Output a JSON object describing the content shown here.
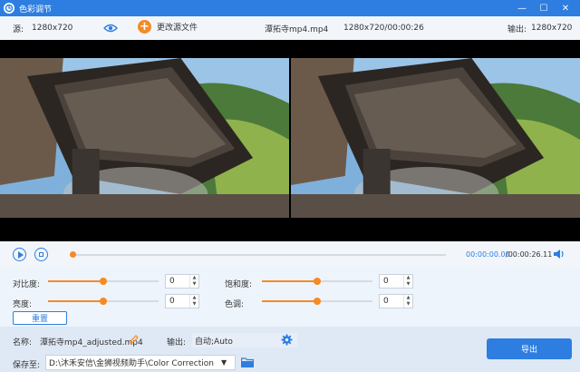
{
  "window": {
    "title": "色彩调节",
    "logo_icon": "app-logo-icon",
    "controls": [
      "minimize-icon",
      "maximize-icon",
      "close-icon"
    ]
  },
  "info_bar": {
    "source_label": "源:",
    "source_resolution": "1280x720",
    "change_source_label": "更改源文件",
    "file_name": "潭拓寺mp4.mp4",
    "file_info": "1280x720/00:00:26",
    "output_label": "输出:",
    "output_resolution": "1280x720"
  },
  "playback": {
    "current_time": "00:00:00.00",
    "total_time": "/00:00:26.11",
    "progress_fraction": 0.0
  },
  "adjustments": {
    "contrast": {
      "label": "对比度:",
      "value": "0",
      "slider_fraction": 0.5
    },
    "saturation": {
      "label": "饱和度:",
      "value": "0",
      "slider_fraction": 0.5
    },
    "brightness": {
      "label": "亮度:",
      "value": "0",
      "slider_fraction": 0.5
    },
    "hue": {
      "label": "色调:",
      "value": "0",
      "slider_fraction": 0.5
    },
    "reset_label": "重置"
  },
  "output": {
    "name_label": "名称:",
    "name_value": "潭拓寺mp4_adjusted.mp4",
    "output_label": "输出:",
    "output_value": "自动;Auto",
    "save_label": "保存至:",
    "save_path": "D:\\沐禾安信\\金狮视频助手\\Color Correction",
    "export_label": "导出"
  },
  "colors": {
    "accent": "#2d7ee0",
    "orange": "#f58a23"
  }
}
